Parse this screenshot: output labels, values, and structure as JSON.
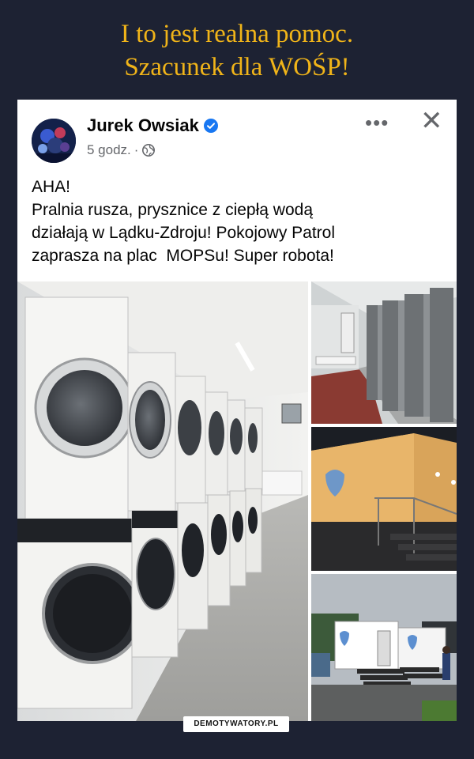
{
  "headline": {
    "line1": "I to jest realna pomoc.",
    "line2": "Szacunek dla WOŚP!"
  },
  "post": {
    "author": "Jurek Owsiak",
    "timestamp": "5 godz.",
    "separator": "·",
    "audience_icon": "globe-icon",
    "verified_icon": "verified-badge-icon",
    "more_icon": "more-options-icon",
    "more_glyph": "•••",
    "close_glyph": "✕",
    "text_lines": [
      "AHA!",
      "Pralnia rusza, prysznice z ciepłą wodą",
      "działają w Lądku-Zdroju! Pokojowy Patrol",
      "zaprasza na plac  MOPSu! Super robota!"
    ]
  },
  "photos": [
    "laundry-room-photo",
    "shower-cabins-photo",
    "container-night-photo",
    "containers-daytime-photo"
  ],
  "watermark": "DEMOTYWATORY.PL",
  "colors": {
    "background": "#1d2233",
    "headline": "#f0b419",
    "verified": "#1877f2",
    "muted": "#65676b"
  }
}
